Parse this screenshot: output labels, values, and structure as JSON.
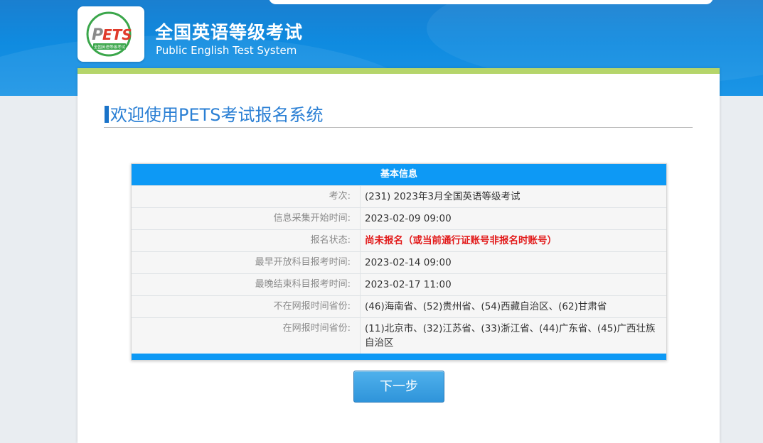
{
  "header": {
    "logo_text": "PETS",
    "logo_caption": "全国英语等级考试",
    "title": "全国英语等级考试",
    "subtitle": "Public English Test System"
  },
  "welcome": "欢迎使用PETS考试报名系统",
  "info": {
    "heading": "基本信息",
    "rows": [
      {
        "label": "考次:",
        "value": "(231) 2023年3月全国英语等级考试"
      },
      {
        "label": "信息采集开始时间:",
        "value": "2023-02-09 09:00"
      },
      {
        "label": "报名状态:",
        "value": "尚未报名（或当前通行证账号非报名时账号）"
      },
      {
        "label": "最早开放科目报考时间:",
        "value": "2023-02-14 09:00"
      },
      {
        "label": "最晚结束科目报考时间:",
        "value": "2023-02-17 11:00"
      },
      {
        "label": "不在网报时间省份:",
        "value": "(46)海南省、(52)贵州省、(54)西藏自治区、(62)甘肃省"
      },
      {
        "label": "在网报时间省份:",
        "value": "(11)北京市、(32)江苏省、(33)浙江省、(44)广东省、(45)广西壮族自治区"
      }
    ]
  },
  "next_button": "下一步",
  "colors": {
    "banner_blue": "#0f8be0",
    "accent_green": "#b5d56a",
    "table_header": "#0d99f5",
    "status_red": "#e21a1a"
  }
}
